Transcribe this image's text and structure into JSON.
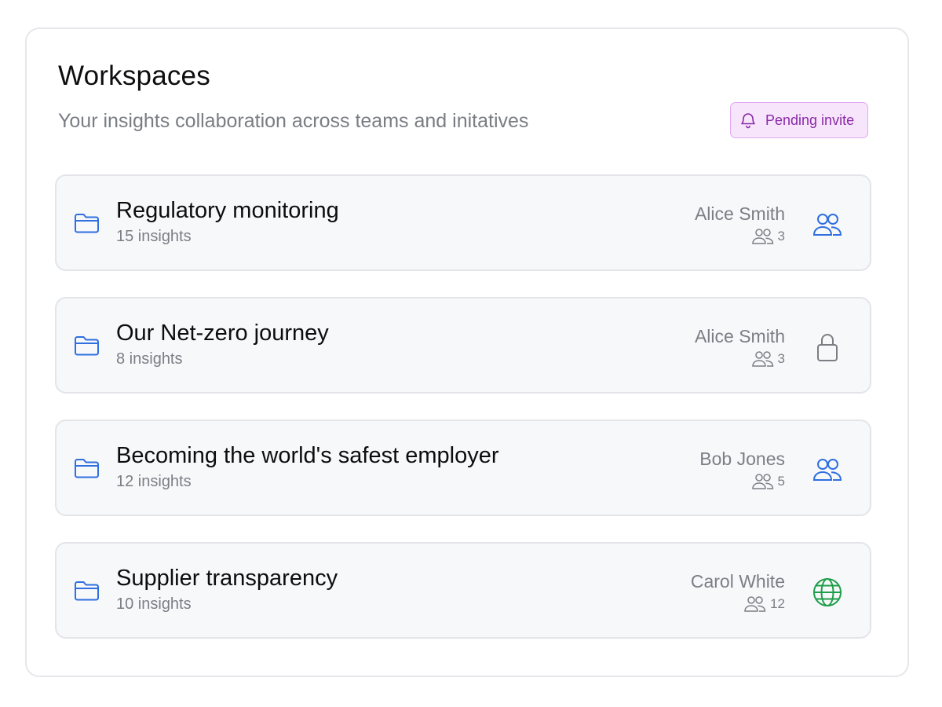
{
  "header": {
    "title": "Workspaces",
    "subtitle": "Your insights collaboration across teams and initatives",
    "invite_label": "Pending invite"
  },
  "colors": {
    "accent_blue": "#2f6fe0",
    "invite_purple": "#8a2aa8",
    "public_green": "#1f9e4a",
    "muted_gray": "#7b7e85"
  },
  "workspaces": [
    {
      "name": "Regulatory monitoring",
      "count": "15 insights",
      "owner": "Alice Smith",
      "members": "3",
      "access": "team",
      "access_icon": "people-icon"
    },
    {
      "name": "Our Net-zero journey",
      "count": "8 insights",
      "owner": "Alice Smith",
      "members": "3",
      "access": "private",
      "access_icon": "lock-icon"
    },
    {
      "name": "Becoming the world's safest employer",
      "count": "12 insights",
      "owner": "Bob Jones",
      "members": "5",
      "access": "team",
      "access_icon": "people-icon"
    },
    {
      "name": "Supplier transparency",
      "count": "10 insights",
      "owner": "Carol White",
      "members": "12",
      "access": "public",
      "access_icon": "globe-icon"
    }
  ]
}
